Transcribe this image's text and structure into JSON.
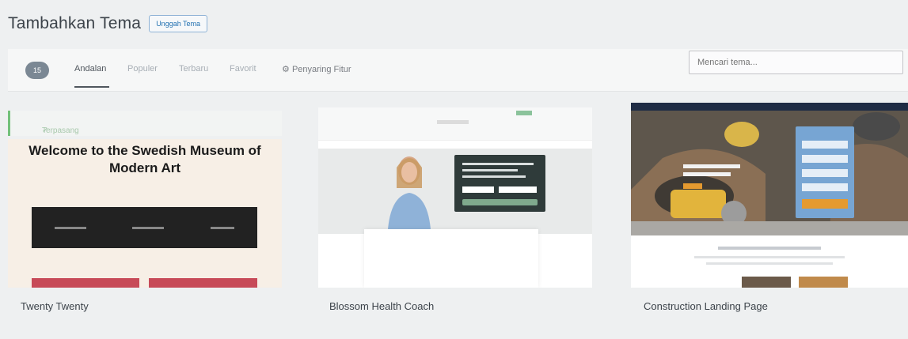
{
  "header": {
    "title": "Tambahkan Tema",
    "upload_label": "Unggah Tema"
  },
  "filter": {
    "count": "15",
    "tabs": [
      "Andalan",
      "Populer",
      "Terbaru",
      "Favorit"
    ],
    "active_tab": "Andalan",
    "feature_filter_label": "Penyaring Fitur",
    "search_placeholder": "Mencari tema..."
  },
  "themes": [
    {
      "name": "Twenty Twenty",
      "installed_label": "Terpasang",
      "preview_headline": "Welcome to the Swedish Museum of Modern Art"
    },
    {
      "name": "Blossom Health Coach"
    },
    {
      "name": "Construction Landing Page"
    }
  ],
  "colors": {
    "accent": "#2271b1",
    "installed_green": "#72c07a",
    "badge": "#7b8894"
  }
}
